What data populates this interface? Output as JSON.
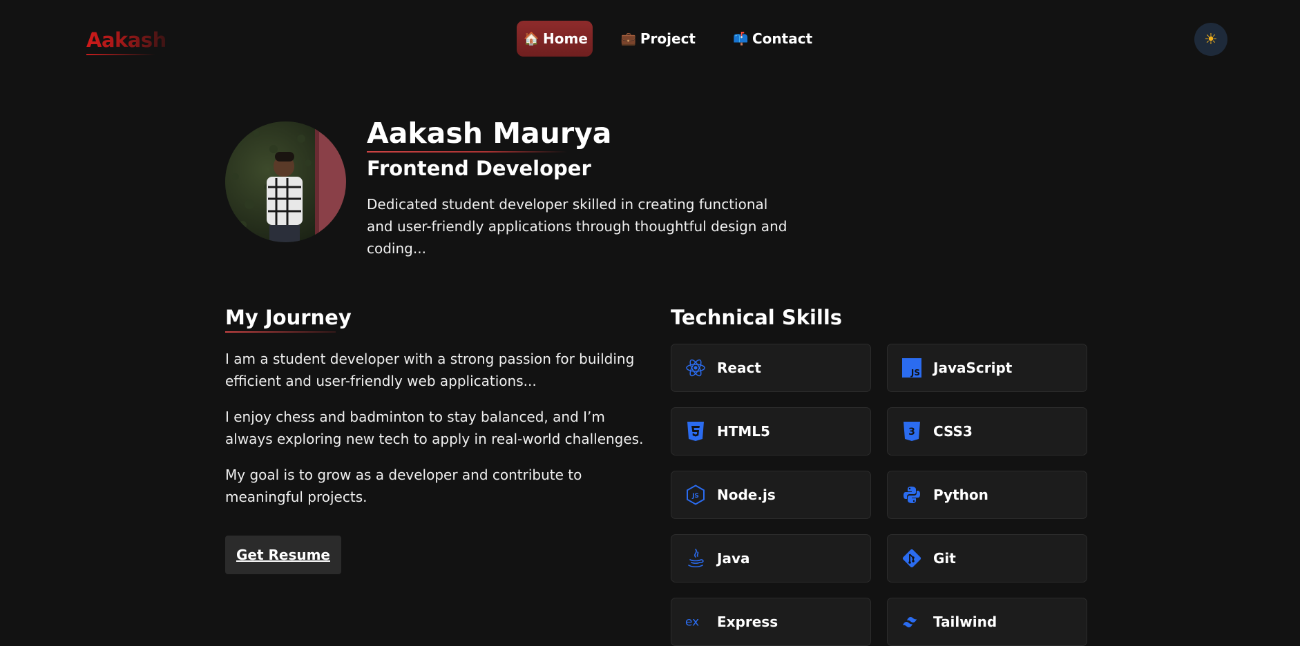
{
  "nav": {
    "logo": "Aakash",
    "items": [
      {
        "icon": "🏠",
        "label": "Home"
      },
      {
        "icon": "💼",
        "label": "Project"
      },
      {
        "icon": "📫",
        "label": "Contact"
      }
    ],
    "theme_icon": "☀"
  },
  "hero": {
    "name": "Aakash Maurya",
    "role": "Frontend Developer",
    "bio": "Dedicated student developer skilled in creating functional and user-friendly applications through thoughtful design and coding..."
  },
  "journey": {
    "title": "My Journey",
    "paragraphs": [
      "I am a student developer with a strong passion for building efficient and user-friendly web applications...",
      "I enjoy chess and badminton to stay balanced, and I’m always exploring new tech to apply in real-world challenges.",
      "My goal is to grow as a developer and contribute to meaningful projects."
    ],
    "resume_label": "Get Resume"
  },
  "skills": {
    "title": "Technical Skills",
    "items": [
      {
        "label": "React",
        "icon": "react-icon"
      },
      {
        "label": "JavaScript",
        "icon": "javascript-icon"
      },
      {
        "label": "HTML5",
        "icon": "html5-icon"
      },
      {
        "label": "CSS3",
        "icon": "css3-icon"
      },
      {
        "label": "Node.js",
        "icon": "nodejs-icon"
      },
      {
        "label": "Python",
        "icon": "python-icon"
      },
      {
        "label": "Java",
        "icon": "java-icon"
      },
      {
        "label": "Git",
        "icon": "git-icon"
      },
      {
        "label": "Express",
        "icon": "express-icon"
      },
      {
        "label": "Tailwind",
        "icon": "tailwind-icon"
      }
    ],
    "icon_color": "#2b6cf0"
  }
}
